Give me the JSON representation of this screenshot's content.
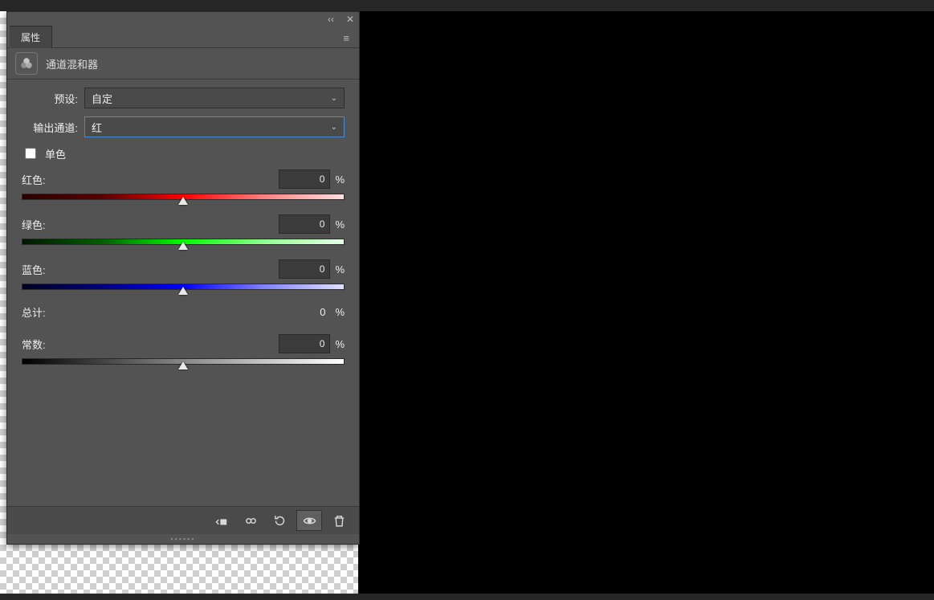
{
  "panel": {
    "tab_label": "属性",
    "adjustment_title": "通道混和器",
    "preset_label": "预设:",
    "preset_value": "自定",
    "output_channel_label": "输出通道:",
    "output_channel_value": "红",
    "monochrome_label": "单色",
    "sliders": {
      "red": {
        "label": "红色:",
        "value": "0",
        "pct": "%"
      },
      "green": {
        "label": "绿色:",
        "value": "0",
        "pct": "%"
      },
      "blue": {
        "label": "蓝色:",
        "value": "0",
        "pct": "%"
      },
      "constant": {
        "label": "常数:",
        "value": "0",
        "pct": "%"
      }
    },
    "total": {
      "label": "总计:",
      "value": "0",
      "pct": "%"
    }
  },
  "icons": {
    "collapse": "‹‹",
    "close": "✕",
    "menu": "≡",
    "chevron": "⌄"
  }
}
